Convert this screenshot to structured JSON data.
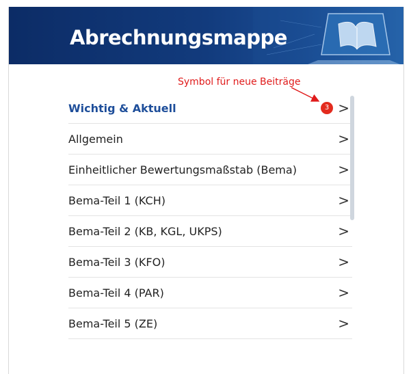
{
  "header": {
    "title": "Abrechnungsmappe"
  },
  "annotation": {
    "text": "Symbol für neue Beiträge"
  },
  "list": {
    "items": [
      {
        "label": "Wichtig & Aktuell",
        "badge": "3"
      },
      {
        "label": "Allgemein"
      },
      {
        "label": "Einheitlicher Bewertungsmaßstab (Bema)"
      },
      {
        "label": "Bema-Teil 1 (KCH)"
      },
      {
        "label": "Bema-Teil 2 (KB, KGL, UKPS)"
      },
      {
        "label": "Bema-Teil 3 (KFO)"
      },
      {
        "label": "Bema-Teil 4 (PAR)"
      },
      {
        "label": "Bema-Teil 5 (ZE)"
      }
    ],
    "chevron": ">"
  },
  "colors": {
    "header_bg": "#123b7d",
    "active_label": "#1e4e9a",
    "badge": "#e32b1e",
    "annotation": "#e01b1b"
  }
}
